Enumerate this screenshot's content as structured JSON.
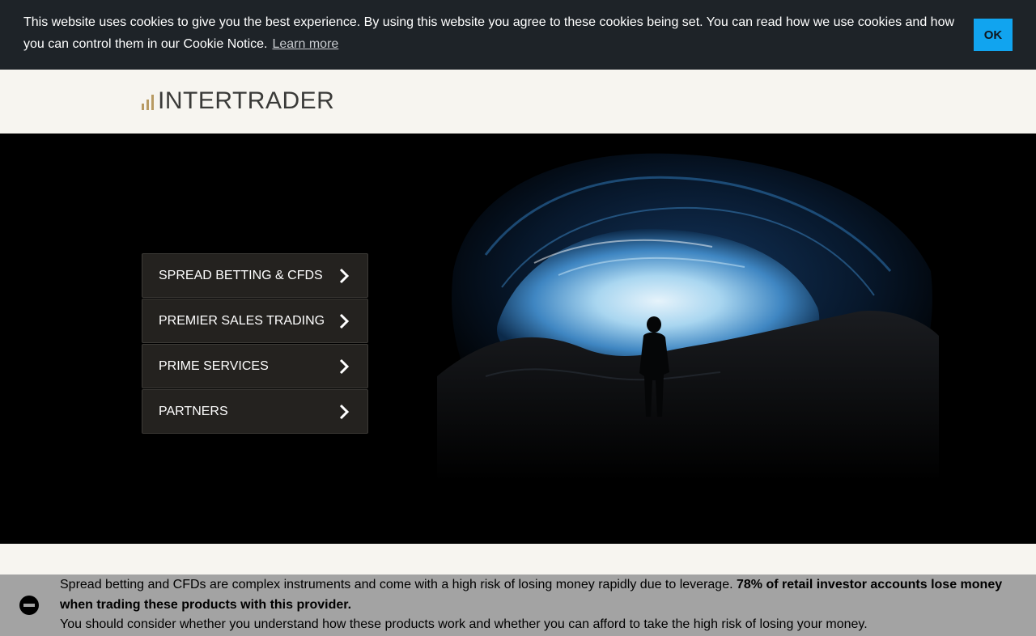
{
  "cookie_banner": {
    "message": "This website uses cookies to give you the best experience. By using this website you agree to these cookies being set. You can read how we use cookies and how you can control them in our Cookie Notice.",
    "learn_more": "Learn more",
    "ok_label": "OK"
  },
  "header": {
    "logo_text": "INTERTRADER"
  },
  "nav": {
    "items": [
      {
        "label": "SPREAD BETTING & CFDS"
      },
      {
        "label": "PREMIER SALES TRADING"
      },
      {
        "label": "PRIME SERVICES"
      },
      {
        "label": "PARTNERS"
      }
    ]
  },
  "risk_warning": {
    "text_1": "Spread betting and CFDs are complex instruments and come with a high risk of losing money rapidly due to leverage.",
    "text_bold": "78% of retail investor accounts lose money when trading these products with this provider.",
    "text_2": "You should consider whether you understand how these products work and whether you can afford to take the high risk of losing your money."
  },
  "colors": {
    "cookie_bg": "#1e2328",
    "ok_button": "#11a4ef",
    "logo_bars": "#b89a62",
    "nav_item_bg": "#24221f",
    "risk_bg": "#a3a3a3",
    "page_bg": "#f7f5f0"
  }
}
